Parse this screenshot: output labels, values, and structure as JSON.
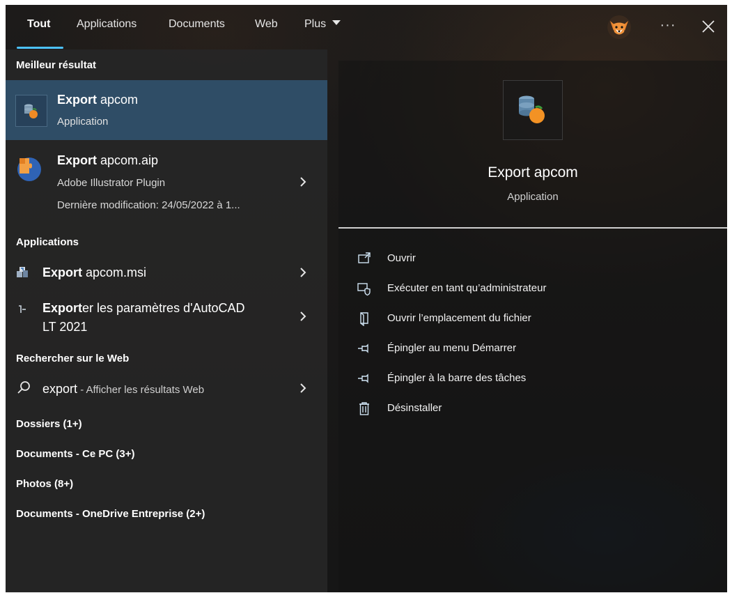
{
  "tabs": [
    {
      "label": "Tout",
      "active": true
    },
    {
      "label": "Applications"
    },
    {
      "label": "Documents"
    },
    {
      "label": "Web"
    },
    {
      "label": "Plus",
      "dropdown": true
    }
  ],
  "topbar": {
    "more_label": "···",
    "avatar_icon": "fox-avatar-icon",
    "close_icon": "close-icon"
  },
  "colors": {
    "accent": "#4cc2ff",
    "selected_row": "#2f4d66",
    "background": "#202020"
  },
  "best_match": {
    "header": "Meilleur résultat",
    "item": {
      "bold": "Export",
      "rest": " apcom",
      "subtitle": "Application",
      "icon": "database-orange-icon"
    }
  },
  "second_result": {
    "bold": "Export",
    "rest": " apcom.aip",
    "line2": "Adobe Illustrator Plugin",
    "line3": "Dernière modification: 24/05/2022 à 1...",
    "icon": "illustrator-plugin-icon"
  },
  "applications": {
    "header": "Applications",
    "items": [
      {
        "bold": "Export",
        "rest": " apcom.msi",
        "icon": "msi-installer-icon"
      },
      {
        "bold": "Export",
        "rest": "er les paramètres d'AutoCAD",
        "line2": "LT 2021",
        "icon": "autocad-export-icon"
      }
    ]
  },
  "web": {
    "header": "Rechercher sur le Web",
    "query": "export",
    "suffix": " - Afficher les résultats Web",
    "icon": "search-icon"
  },
  "categories": [
    "Dossiers (1+)",
    "Documents - Ce PC (3+)",
    "Photos (8+)",
    "Documents - OneDrive Entreprise (2+)"
  ],
  "detail": {
    "title": "Export apcom",
    "subtitle": "Application",
    "icon": "database-orange-icon",
    "actions": [
      {
        "label": "Ouvrir",
        "icon": "open-icon"
      },
      {
        "label": "Exécuter en tant qu’administrateur",
        "icon": "run-as-admin-icon"
      },
      {
        "label": "Ouvrir l’emplacement du fichier",
        "icon": "file-location-icon"
      },
      {
        "label": "Épingler au menu Démarrer",
        "icon": "pin-icon"
      },
      {
        "label": "Épingler à la barre des tâches",
        "icon": "pin-icon"
      },
      {
        "label": "Désinstaller",
        "icon": "trash-icon"
      }
    ]
  }
}
